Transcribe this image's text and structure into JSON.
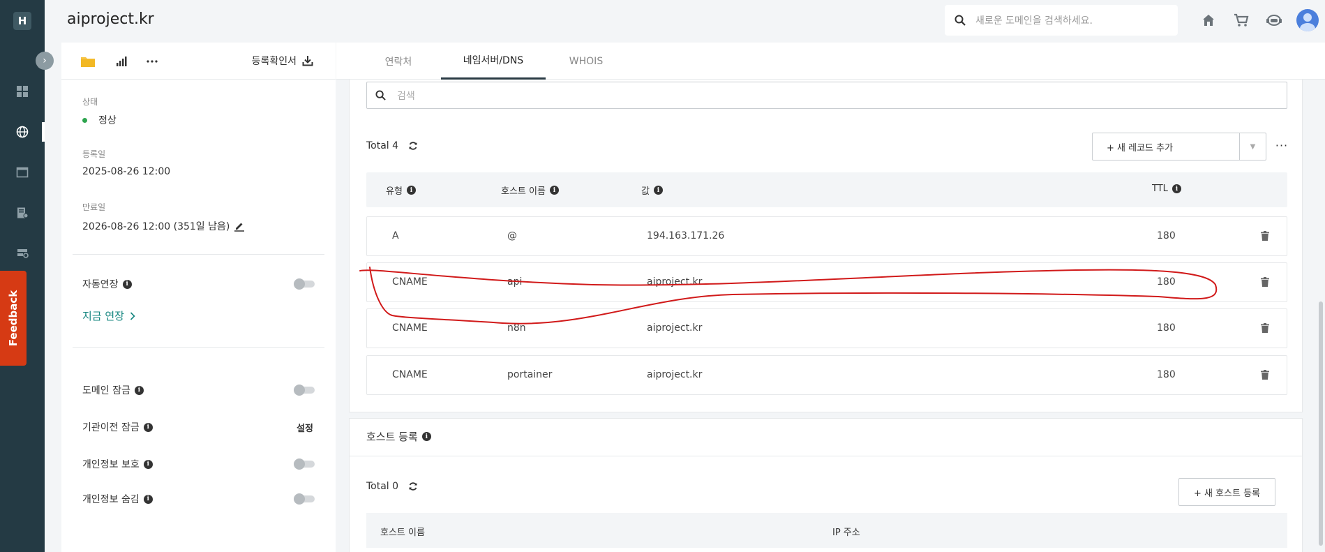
{
  "rail": {
    "logo": "H",
    "expand_glyph": "›",
    "feedback_label": "Feedback"
  },
  "header": {
    "domain": "aiproject.kr",
    "search_placeholder": "새로운 도메인을 검색하세요."
  },
  "left_panel": {
    "certificate_label": "등록확인서",
    "status_label": "상태",
    "status_value": "정상",
    "status_color": "#2da44e",
    "registered_label": "등록일",
    "registered_value": "2025-08-26 12:00",
    "expiry_label": "만료일",
    "expiry_value": "2026-08-26 12:00 (351일 남음)",
    "auto_renew_label": "자동연장",
    "renew_now_label": "지금 연장",
    "domain_lock_label": "도메인 잠금",
    "transfer_lock_label": "기관이전 잠금",
    "transfer_lock_action": "설정",
    "privacy_protect_label": "개인정보 보호",
    "privacy_hide_label": "개인정보 숨김"
  },
  "tabs": [
    {
      "label": "연락처",
      "active": false
    },
    {
      "label": "네임서버/DNS",
      "active": true
    },
    {
      "label": "WHOIS",
      "active": false
    }
  ],
  "dns": {
    "search_placeholder": "검색",
    "total_label": "Total 4",
    "add_record_label": "+ 새 레코드 추가",
    "more_label": "···",
    "columns": [
      "유형",
      "호스트 이름",
      "값",
      "TTL"
    ],
    "records": [
      {
        "type": "A",
        "host": "@",
        "value": "194.163.171.26",
        "ttl": "180"
      },
      {
        "type": "CNAME",
        "host": "api",
        "value": "aiproject.kr",
        "ttl": "180"
      },
      {
        "type": "CNAME",
        "host": "n8n",
        "value": "aiproject.kr",
        "ttl": "180"
      },
      {
        "type": "CNAME",
        "host": "portainer",
        "value": "aiproject.kr",
        "ttl": "180"
      }
    ]
  },
  "host_registration": {
    "title": "호스트 등록",
    "total_label": "Total 0",
    "add_host_label": "+ 새 호스트 등록",
    "columns": [
      "호스트 이름",
      "IP 주소"
    ]
  },
  "colors": {
    "rail_bg": "#243a44",
    "feedback_bg": "#d63a14",
    "link_teal": "#14857f",
    "annotation_red": "#d11a1a"
  }
}
